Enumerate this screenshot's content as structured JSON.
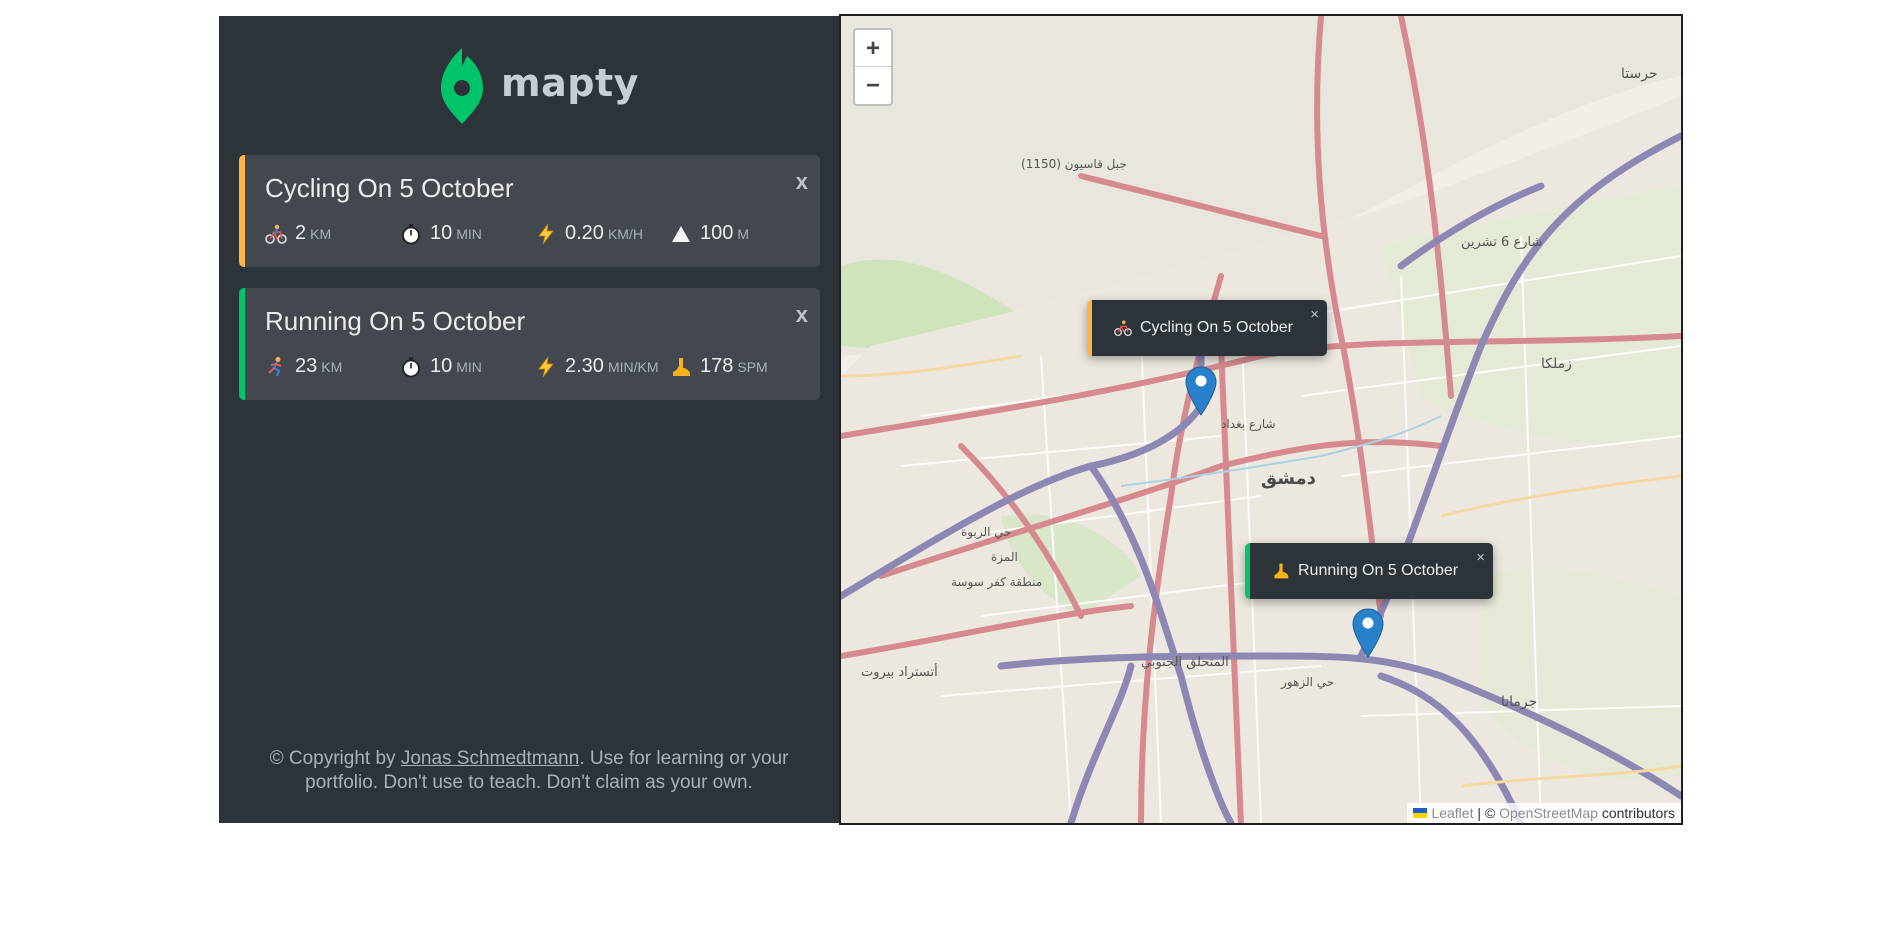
{
  "app": {
    "name": "mapty"
  },
  "colors": {
    "cycling": "#ffb545",
    "running": "#00c46a",
    "sidebar": "#2d3439",
    "card": "#42484d"
  },
  "workouts": [
    {
      "type": "cycling",
      "title": "Cycling On 5 October",
      "close": "x",
      "stats": [
        {
          "icon": "bicycle-icon",
          "value": "2",
          "unit": "km"
        },
        {
          "icon": "stopwatch-icon",
          "value": "10",
          "unit": "min"
        },
        {
          "icon": "lightning-icon",
          "value": "0.20",
          "unit": "km/h"
        },
        {
          "icon": "mountain-icon",
          "value": "100",
          "unit": "m"
        }
      ]
    },
    {
      "type": "running",
      "title": "Running On 5 October",
      "close": "x",
      "stats": [
        {
          "icon": "runner-icon",
          "value": "23",
          "unit": "km"
        },
        {
          "icon": "stopwatch-icon",
          "value": "10",
          "unit": "min"
        },
        {
          "icon": "lightning-icon",
          "value": "2.30",
          "unit": "min/km"
        },
        {
          "icon": "footprint-icon",
          "value": "178",
          "unit": "spm"
        }
      ]
    }
  ],
  "copyright": {
    "before": "© Copyright by ",
    "link": "Jonas Schmedtmann",
    "after": ". Use for learning or your portfolio. Don't use to teach. Don't claim as your own."
  },
  "map": {
    "zoom_in": "+",
    "zoom_out": "−",
    "popups": [
      {
        "text": "Cycling On 5 October",
        "close": "×"
      },
      {
        "text": "Running On 5 October",
        "close": "×"
      }
    ],
    "labels": {
      "damascus": "دمشق",
      "harasta": "حرستا",
      "zamalka": "زملكا",
      "jaramana": "جرمانا",
      "beirut_road": "أتستراد بيروت",
      "southern_zone": "المتحلق الجنوبي",
      "qasioun": "جبل قاسيون (1150)",
      "mezzeh": "المزة",
      "kafr_sousa": "منطقة كفر سوسة",
      "zahira": "حي الزهور",
      "rabweh": "حي الربوة",
      "october6": "شارع 6 تشرين",
      "baghdad": "شارع بغداد"
    },
    "attribution": {
      "leaflet": "Leaflet",
      "separator": " | © ",
      "osm": "OpenStreetMap",
      "contributors": " contributors"
    }
  }
}
